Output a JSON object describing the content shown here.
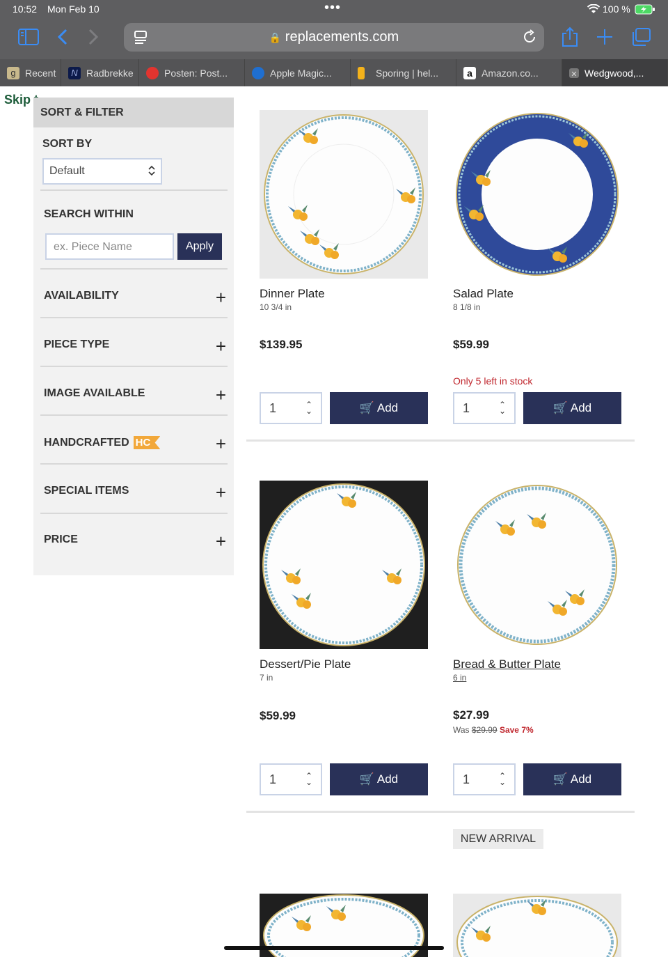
{
  "status_bar": {
    "time": "10:52",
    "date": "Mon Feb 10",
    "battery": "100 %"
  },
  "browser": {
    "url": "replacements.com",
    "tabs": [
      {
        "label": "Recent",
        "icon": "g-icon"
      },
      {
        "label": "Radbrekke",
        "icon": "n-icon"
      },
      {
        "label": "Posten: Post...",
        "icon": "posten-icon"
      },
      {
        "label": "Apple Magic...",
        "icon": "apple-icon"
      },
      {
        "label": "Sporing | hel...",
        "icon": "sporing-icon"
      },
      {
        "label": "Amazon.co...",
        "icon": "amazon-icon"
      },
      {
        "label": "Wedgwood,...",
        "icon": "close-icon"
      }
    ]
  },
  "skip_link": "Skip t",
  "sidebar": {
    "title": "SORT & FILTER",
    "sort_by_label": "SORT BY",
    "sort_value": "Default",
    "search_within_label": "SEARCH WITHIN",
    "search_placeholder": "ex. Piece Name",
    "apply_label": "Apply",
    "facets": [
      "AVAILABILITY",
      "PIECE TYPE",
      "IMAGE AVAILABLE",
      "HANDCRAFTED",
      "SPECIAL ITEMS",
      "PRICE"
    ],
    "hc_badge": "HC"
  },
  "products": [
    {
      "name": "Dinner Plate",
      "size": "10 3/4 in",
      "price": "$139.95",
      "qty": "1",
      "add": "Add"
    },
    {
      "name": "Salad Plate",
      "size": "8 1/8 in",
      "price": "$59.99",
      "stock_note": "Only 5 left in stock",
      "qty": "1",
      "add": "Add"
    },
    {
      "name": "Dessert/Pie Plate",
      "size": "7 in",
      "price": "$59.99",
      "qty": "1",
      "add": "Add"
    },
    {
      "name": "Bread & Butter Plate",
      "size": "6 in",
      "price": "$27.99",
      "was_label": "Was",
      "was_price": "$29.99",
      "save": "Save 7%",
      "qty": "1",
      "add": "Add"
    }
  ],
  "new_arrival": "NEW ARRIVAL",
  "colors": {
    "chrome": "#5e5e60",
    "accent": "#293158",
    "alert": "#c0262d",
    "badge": "#f2a83a"
  }
}
